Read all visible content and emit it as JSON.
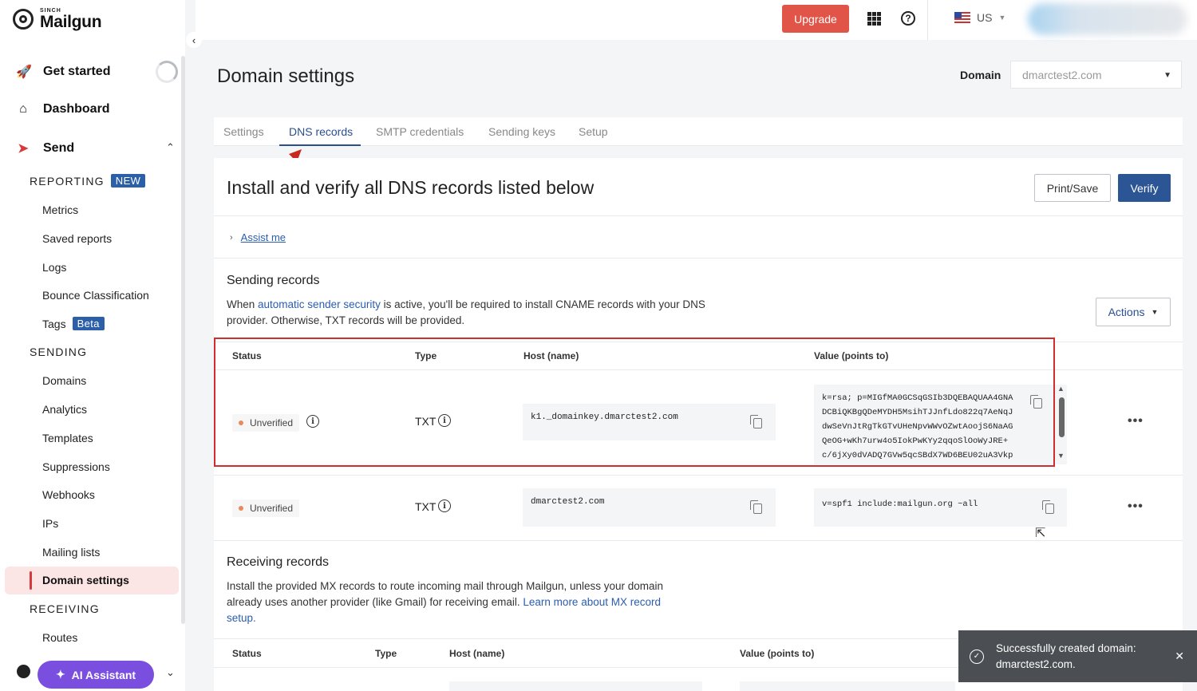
{
  "brand": {
    "superscript": "SINCH",
    "name": "Mailgun"
  },
  "sidebar": {
    "top_items": [
      {
        "label": "Get started",
        "icon": "rocket-icon"
      },
      {
        "label": "Dashboard",
        "icon": "home-icon"
      },
      {
        "label": "Send",
        "icon": "send-icon"
      }
    ],
    "reporting": {
      "heading": "REPORTING",
      "badge": "NEW",
      "items": [
        "Metrics",
        "Saved reports",
        "Logs",
        "Bounce Classification",
        "Tags"
      ],
      "tags_badge": "Beta"
    },
    "sending": {
      "heading": "SENDING",
      "items": [
        "Domains",
        "Analytics",
        "Templates",
        "Suppressions",
        "Webhooks",
        "IPs",
        "Mailing lists",
        "Domain settings"
      ],
      "active": "Domain settings"
    },
    "receiving": {
      "heading": "RECEIVING",
      "items": [
        "Routes"
      ]
    },
    "ai_button": "AI Assistant"
  },
  "topbar": {
    "upgrade": "Upgrade",
    "region": "US"
  },
  "page": {
    "title": "Domain settings",
    "domain_label": "Domain",
    "domain_value": "dmarctest2.com",
    "tabs": [
      "Settings",
      "DNS records",
      "SMTP credentials",
      "Sending keys",
      "Setup"
    ],
    "active_tab": "DNS records"
  },
  "card": {
    "title": "Install and verify all DNS records listed below",
    "print_save": "Print/Save",
    "verify": "Verify",
    "assist": "Assist me"
  },
  "sending_records": {
    "title": "Sending records",
    "desc_pre": "When ",
    "desc_link": "automatic sender security",
    "desc_post": " is active, you'll be required to install CNAME records with your DNS provider. Otherwise, TXT records will be provided.",
    "actions": "Actions",
    "headers": [
      "Status",
      "Type",
      "Host (name)",
      "Value (points to)"
    ],
    "rows": [
      {
        "status": "Unverified",
        "type": "TXT",
        "host": "k1._domainkey.dmarctest2.com",
        "value_lines": [
          "k=rsa; p=MIGfMA0GCSqGSIb3DQEBAQUAA4GNA",
          "DCBiQKBgQDeMYDH5MsihTJJnfLdo822q7AeNqJ",
          "dwSeVnJtRgTkGTvUHeNpvWWvOZwtAoojS6NaAG",
          "QeOG+wKh7urw4o5IokPwKYy2qqoSlOoWyJRE+",
          "c/6jXy0dVADQ7GVw5qcSBdX7WD6BEU02uA3Vkp"
        ]
      },
      {
        "status": "Unverified",
        "type": "TXT",
        "host": "dmarctest2.com",
        "value_lines": [
          "v=spf1 include:mailgun.org ~all"
        ]
      }
    ]
  },
  "receiving_records": {
    "title": "Receiving records",
    "desc_pre": "Install the provided MX records to route incoming mail through Mailgun, unless your domain already uses another provider (like Gmail) for receiving email. ",
    "desc_link": "Learn more about MX record setup.",
    "headers": [
      "Status",
      "Type",
      "Host (name)",
      "Value (points to)"
    ]
  },
  "toast": {
    "message": "Successfully created domain: dmarctest2.com."
  },
  "colors": {
    "accent": "#2b5594",
    "upgrade": "#e05548",
    "highlight": "#d02d2d",
    "ai": "#7a4fe0",
    "active_nav": "#fbe5e5"
  }
}
